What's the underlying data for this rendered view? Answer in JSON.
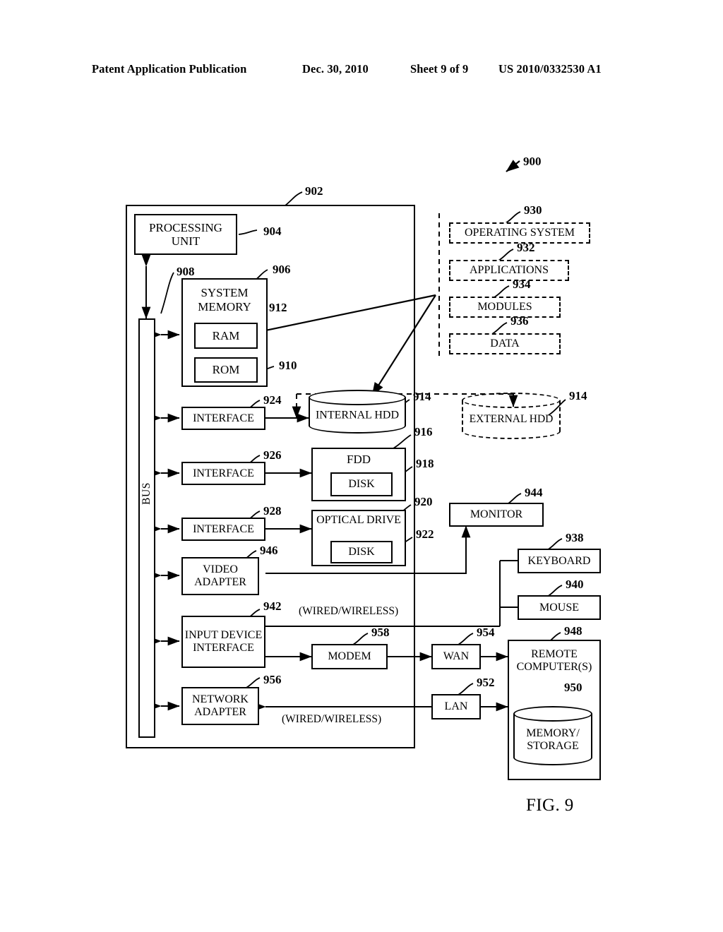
{
  "header": {
    "publication": "Patent Application Publication",
    "date": "Dec. 30, 2010",
    "sheet": "Sheet 9 of 9",
    "number": "US 2010/0332530 A1"
  },
  "figure": {
    "caption": "FIG. 9",
    "system_ref": "900"
  },
  "computer": {
    "ref": "902",
    "processing_unit": {
      "label": "PROCESSING UNIT",
      "ref": "904"
    },
    "bus": {
      "label": "BUS",
      "ref": "908"
    },
    "system_memory": {
      "label": "SYSTEM MEMORY",
      "ref": "906",
      "ram": {
        "label": "RAM",
        "ref": "912"
      },
      "rom": {
        "label": "ROM",
        "ref": "910"
      }
    },
    "interfaces": [
      {
        "label": "INTERFACE",
        "ref": "924"
      },
      {
        "label": "INTERFACE",
        "ref": "926"
      },
      {
        "label": "INTERFACE",
        "ref": "928"
      }
    ],
    "video_adapter": {
      "label": "VIDEO ADAPTER",
      "ref": "946"
    },
    "input_device_interface": {
      "label": "INPUT DEVICE INTERFACE",
      "ref": "942"
    },
    "network_adapter": {
      "label": "NETWORK ADAPTER",
      "ref": "956"
    }
  },
  "storage": {
    "internal_hdd": {
      "label": "INTERNAL HDD",
      "ref": "914"
    },
    "external_hdd": {
      "label": "EXTERNAL HDD",
      "ref": "914"
    },
    "fdd": {
      "label": "FDD",
      "ref": "916",
      "disk": {
        "label": "DISK",
        "ref": "918"
      }
    },
    "optical_drive": {
      "label": "OPTICAL DRIVE",
      "ref": "920",
      "disk": {
        "label": "DISK",
        "ref": "922"
      }
    }
  },
  "software": [
    {
      "label": "OPERATING SYSTEM",
      "ref": "930"
    },
    {
      "label": "APPLICATIONS",
      "ref": "932"
    },
    {
      "label": "MODULES",
      "ref": "934"
    },
    {
      "label": "DATA",
      "ref": "936"
    }
  ],
  "peripherals": {
    "monitor": {
      "label": "MONITOR",
      "ref": "944"
    },
    "keyboard": {
      "label": "KEYBOARD",
      "ref": "938"
    },
    "mouse": {
      "label": "MOUSE",
      "ref": "940"
    }
  },
  "network": {
    "modem": {
      "label": "MODEM",
      "ref": "958"
    },
    "wan": {
      "label": "WAN",
      "ref": "954"
    },
    "lan": {
      "label": "LAN",
      "ref": "952"
    },
    "remote_computer": {
      "label": "REMOTE COMPUTER(S)",
      "ref": "948"
    },
    "memory_storage": {
      "label": "MEMORY/ STORAGE",
      "ref": "950"
    },
    "link_label_top": "(WIRED/WIRELESS)",
    "link_label_bottom": "(WIRED/WIRELESS)"
  }
}
